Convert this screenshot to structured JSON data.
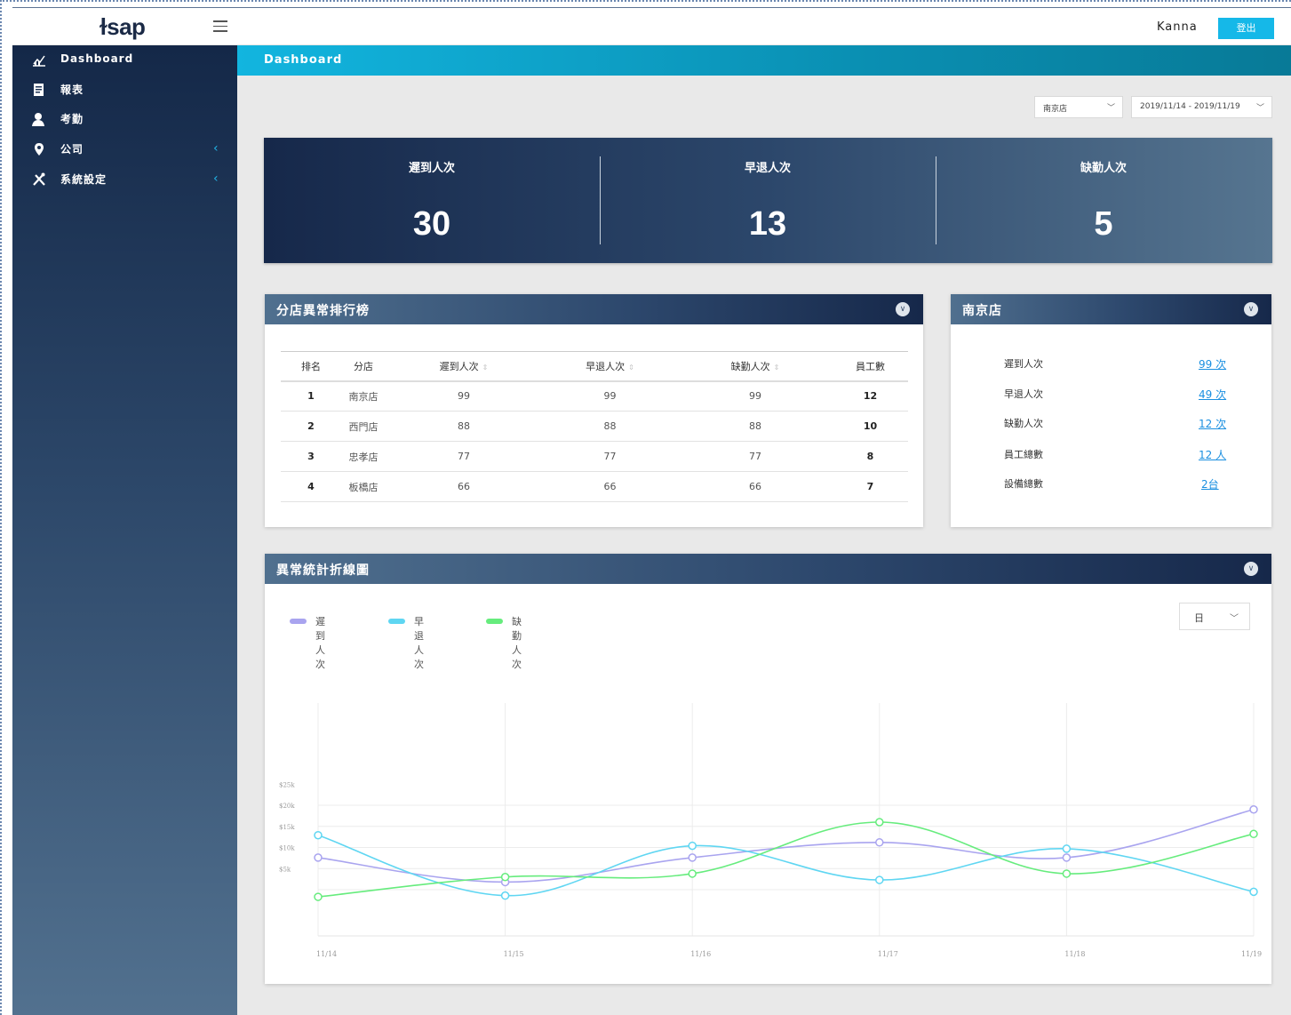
{
  "header": {
    "logo": "ɫsap",
    "username": "Kanna",
    "logout_label": "登出"
  },
  "sidebar": {
    "items": [
      {
        "label": "Dashboard",
        "icon": "chart-icon"
      },
      {
        "label": "報表",
        "icon": "report-icon"
      },
      {
        "label": "考勤",
        "icon": "user-icon"
      },
      {
        "label": "公司",
        "icon": "location-pin-icon",
        "expandable": true
      },
      {
        "label": "系統設定",
        "icon": "tools-icon",
        "expandable": true
      }
    ]
  },
  "page": {
    "title": "Dashboard"
  },
  "filters": {
    "store": "南京店",
    "date_range": "2019/11/14 - 2019/11/19"
  },
  "stats": [
    {
      "label": "遲到人次",
      "value": "30"
    },
    {
      "label": "早退人次",
      "value": "13"
    },
    {
      "label": "缺勤人次",
      "value": "5"
    }
  ],
  "ranking": {
    "title": "分店異常排行榜",
    "columns": [
      "排名",
      "分店",
      "遲到人次",
      "早退人次",
      "缺勤人次",
      "員工數"
    ],
    "rows": [
      {
        "rank": "1",
        "store": "南京店",
        "late": "99",
        "early": "99",
        "absent": "99",
        "staff": "12"
      },
      {
        "rank": "2",
        "store": "西門店",
        "late": "88",
        "early": "88",
        "absent": "88",
        "staff": "10"
      },
      {
        "rank": "3",
        "store": "忠孝店",
        "late": "77",
        "early": "77",
        "absent": "77",
        "staff": "8"
      },
      {
        "rank": "4",
        "store": "板橋店",
        "late": "66",
        "early": "66",
        "absent": "66",
        "staff": "7"
      }
    ]
  },
  "store_card": {
    "title": "南京店",
    "rows": [
      {
        "label": "遲到人次",
        "value": "99 次"
      },
      {
        "label": "早退人次",
        "value": "49 次"
      },
      {
        "label": "缺勤人次",
        "value": "12 次"
      },
      {
        "label": "員工總數",
        "value": "12 人"
      },
      {
        "label": "設備總數",
        "value": "2台"
      }
    ]
  },
  "line_card": {
    "title": "異常統計折線圖",
    "period": "日"
  },
  "colors": {
    "late": "#a9a4ef",
    "early": "#5fd6f2",
    "absent": "#66ec7d",
    "accent": "#15b8e8"
  },
  "chart_data": {
    "type": "line",
    "x": [
      "11/14",
      "11/15",
      "11/16",
      "11/17",
      "11/18",
      "11/19"
    ],
    "y_ticks": [
      "$25k",
      "$20k",
      "$15k",
      "$10k",
      "$5k"
    ],
    "ylim": [
      0,
      25000
    ],
    "series": [
      {
        "name": "遲到人次",
        "values": [
          7600,
          1800,
          7600,
          11200,
          7600,
          19000
        ]
      },
      {
        "name": "早退人次",
        "values": [
          12900,
          -1400,
          10400,
          2300,
          9700,
          -500
        ]
      },
      {
        "name": "缺勤人次",
        "values": [
          -1700,
          3000,
          3800,
          16000,
          3800,
          13200
        ]
      }
    ],
    "grid": true,
    "legend": "top-left"
  }
}
